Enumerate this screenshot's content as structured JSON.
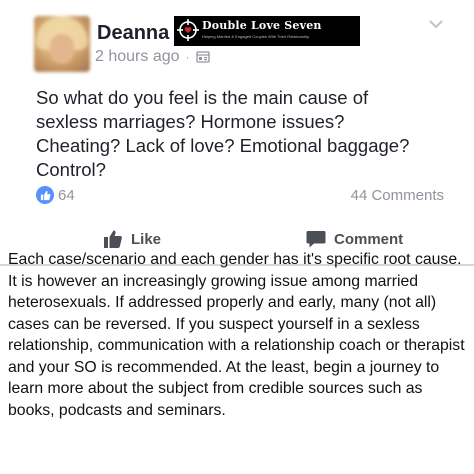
{
  "post": {
    "author": "Deanna",
    "timestamp": "2 hours ago",
    "separator": "·",
    "privacy_icon": "globe-icon",
    "text": "So what do you feel is the main cause of\nsexless marriages?  Hormone issues?\nCheating? Lack of love?  Emotional baggage?\nControl?",
    "reactions": {
      "like_count": "64"
    },
    "comments_count": "44 Comments",
    "actions": {
      "like_label": "Like",
      "comment_label": "Comment"
    }
  },
  "logo": {
    "title": "Double Love Seven",
    "tagline": "Helping Married & Engaged Couples With Their Relationship"
  },
  "caption": "Each case/scenario and each gender has it's specific root cause. It is however an increasingly growing issue among married heterosexuals. If addressed properly and early, many (not all) cases can be reversed. If you suspect yourself in a sexless relationship, communication with a relationship coach or therapist and your SO is recommended. At the least, begin a journey to learn more about the subject from credible sources such as books, podcasts and seminars.",
  "colors": {
    "accent": "#5890ff",
    "meta_text": "#90949c",
    "action_text": "#4b4f56",
    "logo_background": "#000000"
  }
}
